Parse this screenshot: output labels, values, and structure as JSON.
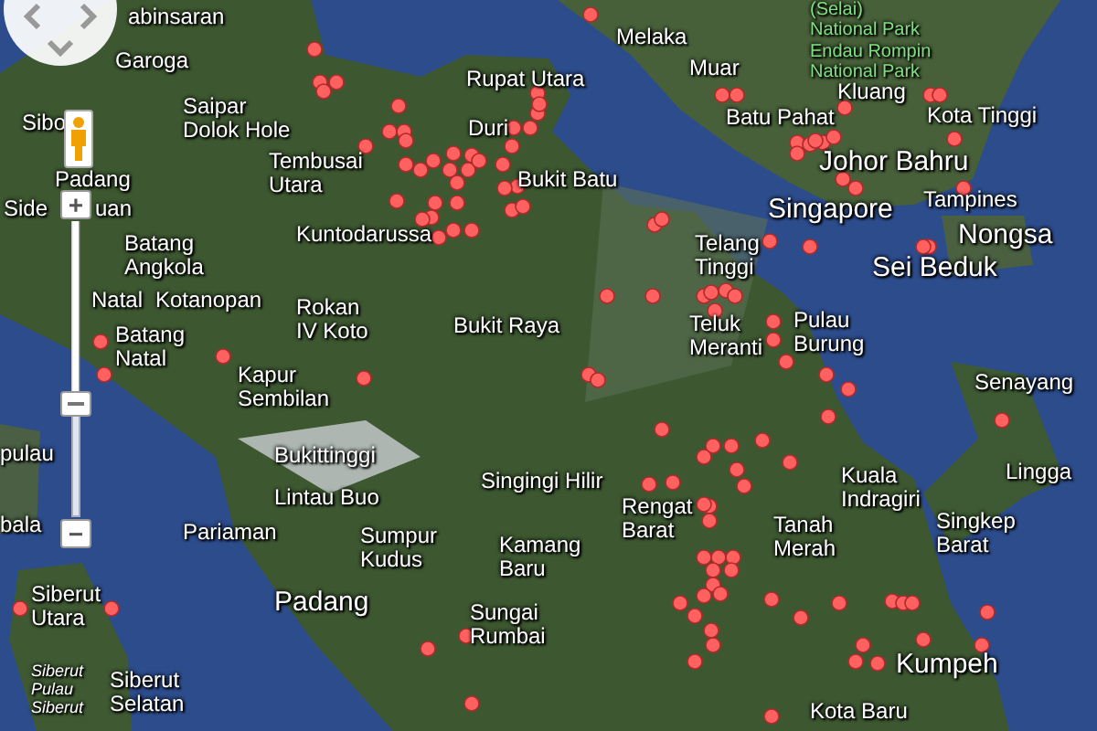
{
  "map": {
    "labels": [
      {
        "text": "abinsaran",
        "kind": "city"
      },
      {
        "text": "Garoga",
        "kind": "city"
      },
      {
        "text": "Sibo",
        "kind": "city"
      },
      {
        "text": "Saipar\nDolok Hole",
        "kind": "city"
      },
      {
        "text": "Padang",
        "kind": "city"
      },
      {
        "text": "Side",
        "kind": "city"
      },
      {
        "text": "uan",
        "kind": "city"
      },
      {
        "text": "Tembusai\nUtara",
        "kind": "city"
      },
      {
        "text": "Kuntodarussa",
        "kind": "city"
      },
      {
        "text": "Batang\nAngkola",
        "kind": "city"
      },
      {
        "text": "Natal",
        "kind": "city"
      },
      {
        "text": "Kotanopan",
        "kind": "city"
      },
      {
        "text": "Rokan\nIV Koto",
        "kind": "city"
      },
      {
        "text": "Batang\nNatal",
        "kind": "city"
      },
      {
        "text": "Rupat Utara",
        "kind": "city"
      },
      {
        "text": "Duri",
        "kind": "city"
      },
      {
        "text": "Bukit Batu",
        "kind": "city"
      },
      {
        "text": "Bukit Raya",
        "kind": "city"
      },
      {
        "text": "(Selai)\nNational Park",
        "kind": "park"
      },
      {
        "text": "Endau Rompin\nNational Park",
        "kind": "park"
      },
      {
        "text": "Melaka",
        "kind": "city"
      },
      {
        "text": "Muar",
        "kind": "city"
      },
      {
        "text": "Kluang",
        "kind": "city"
      },
      {
        "text": "Batu Pahat",
        "kind": "city"
      },
      {
        "text": "Kota Tinggi",
        "kind": "city"
      },
      {
        "text": "Johor Bahru",
        "kind": "major"
      },
      {
        "text": "Singapore",
        "kind": "major"
      },
      {
        "text": "Tampines",
        "kind": "city"
      },
      {
        "text": "Telang\nTinggi",
        "kind": "city"
      },
      {
        "text": "Nongsa",
        "kind": "major"
      },
      {
        "text": "Sei Beduk",
        "kind": "major"
      },
      {
        "text": "Teluk\nMeranti",
        "kind": "city"
      },
      {
        "text": "Pulau\nBurung",
        "kind": "city"
      },
      {
        "text": "Kapur\nSembilan",
        "kind": "city"
      },
      {
        "text": "Senayang",
        "kind": "city"
      },
      {
        "text": "pulau",
        "kind": "city"
      },
      {
        "text": "bala",
        "kind": "city"
      },
      {
        "text": "Pariaman",
        "kind": "city"
      },
      {
        "text": "Bukittinggi",
        "kind": "city"
      },
      {
        "text": "Lintau Buo",
        "kind": "city"
      },
      {
        "text": "Sumpur\nKudus",
        "kind": "city"
      },
      {
        "text": "Singingi Hilir",
        "kind": "city"
      },
      {
        "text": "Kamang\nBaru",
        "kind": "city"
      },
      {
        "text": "Rengat\nBarat",
        "kind": "city"
      },
      {
        "text": "Tanah\nMerah",
        "kind": "city"
      },
      {
        "text": "Kuala\nIndragiri",
        "kind": "city"
      },
      {
        "text": "Singkep\nBarat",
        "kind": "city"
      },
      {
        "text": "Lingga",
        "kind": "city"
      },
      {
        "text": "Siberut\nUtara",
        "kind": "city"
      },
      {
        "text": "Padang",
        "kind": "major"
      },
      {
        "text": "Sungai\nRumbai",
        "kind": "city"
      },
      {
        "text": "Kumpeh",
        "kind": "major"
      },
      {
        "text": "Siberut\nPulau\nSiberut",
        "kind": "minor"
      },
      {
        "text": "Siberut\nSelatan",
        "kind": "city"
      },
      {
        "text": "Kota Baru",
        "kind": "city"
      }
    ]
  },
  "controls": {
    "zoom_in": "+",
    "zoom": {
      "level": 0.38
    },
    "zoom_out": "−"
  }
}
